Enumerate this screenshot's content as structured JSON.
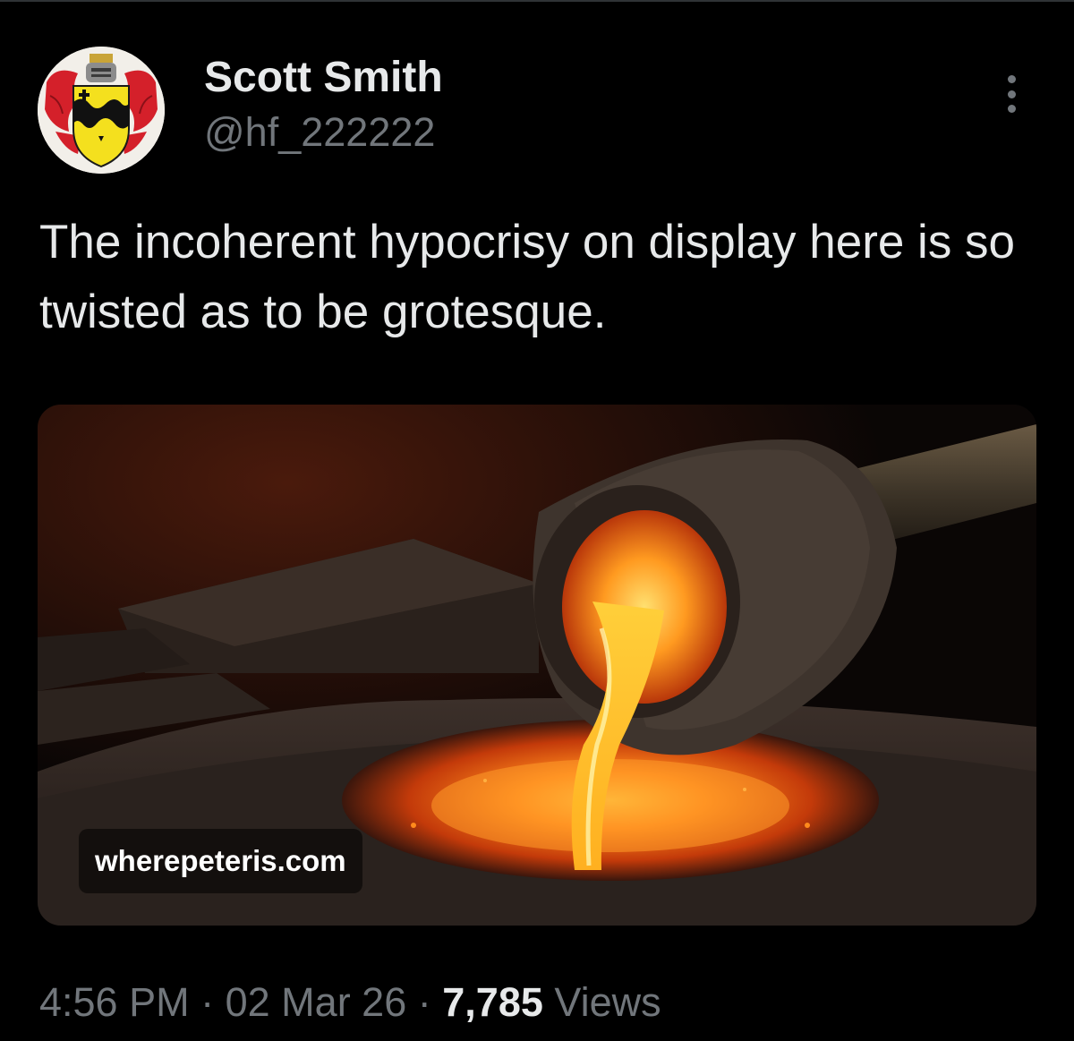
{
  "colors": {
    "background": "#000000",
    "primary_text": "#e7e9ea",
    "secondary_text": "#71767b",
    "divider": "#2f3336"
  },
  "author": {
    "display_name": "Scott Smith",
    "handle": "@hf_222222",
    "avatar_icon": "coat-of-arms-avatar"
  },
  "tweet": {
    "text": "The incoherent hypocrisy on display here is so twisted as to be grotesque."
  },
  "media": {
    "description_icon": "molten-metal-crucible-image",
    "link_domain": "wherepeteris.com"
  },
  "meta": {
    "time": "4:56 PM",
    "separator": "·",
    "date": "02 Mar 26",
    "views_count": "7,785",
    "views_label": "Views"
  },
  "more_menu_icon": "more-vertical-icon"
}
